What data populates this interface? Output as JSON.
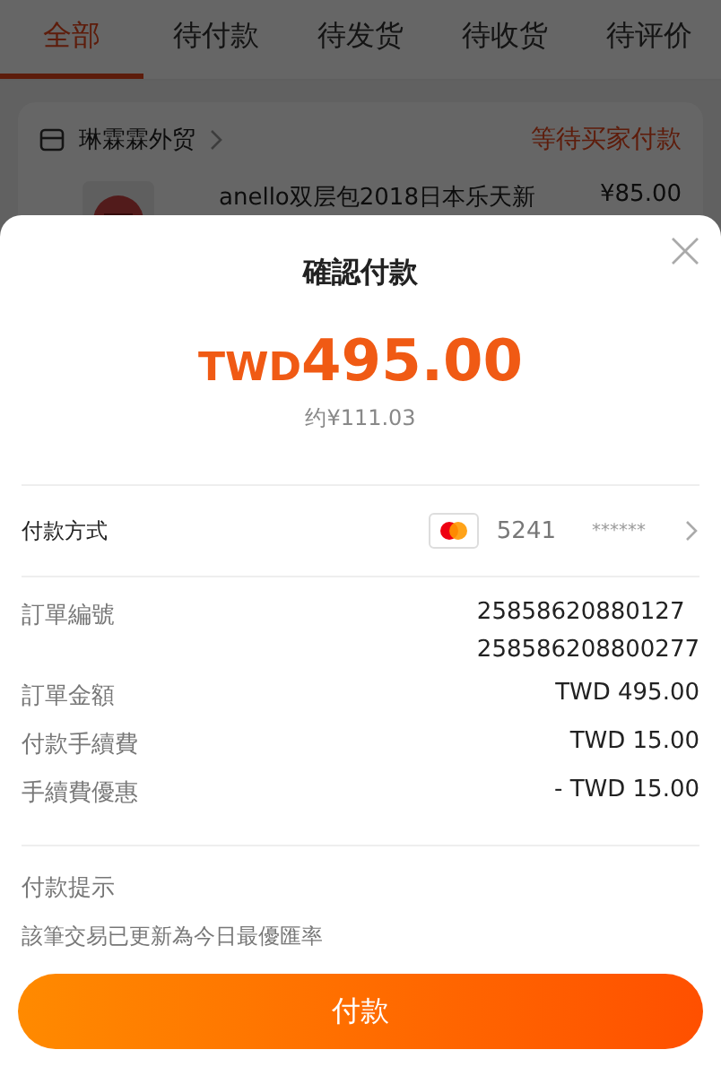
{
  "background": {
    "tabs": [
      {
        "label": "全部",
        "selected": true
      },
      {
        "label": "待付款",
        "selected": false
      },
      {
        "label": "待发货",
        "selected": false
      },
      {
        "label": "待收货",
        "selected": false
      },
      {
        "label": "待评价",
        "selected": false
      }
    ],
    "store": {
      "name": "琳霖霖外贸",
      "status": "等待买家付款"
    },
    "product": {
      "title": "anello双层包2018日本乐天新",
      "price": "¥85.00"
    }
  },
  "dialog": {
    "title": "確認付款",
    "currency": "TWD",
    "amount": "495.00",
    "approx": "约¥111.03",
    "payment_method": {
      "label": "付款方式",
      "card_number": "5241",
      "masked": "******"
    },
    "details": [
      {
        "label": "訂單編號",
        "values": [
          "25858620880127",
          "258586208800277"
        ]
      },
      {
        "label": "訂單金額",
        "values": [
          "TWD 495.00"
        ]
      },
      {
        "label": "付款手續費",
        "values": [
          "TWD 15.00"
        ]
      },
      {
        "label": "手續費優惠",
        "values": [
          "- TWD 15.00"
        ]
      }
    ],
    "tip": {
      "title": "付款提示",
      "text": "該筆交易已更新為今日最優匯率"
    },
    "button": "付款"
  }
}
